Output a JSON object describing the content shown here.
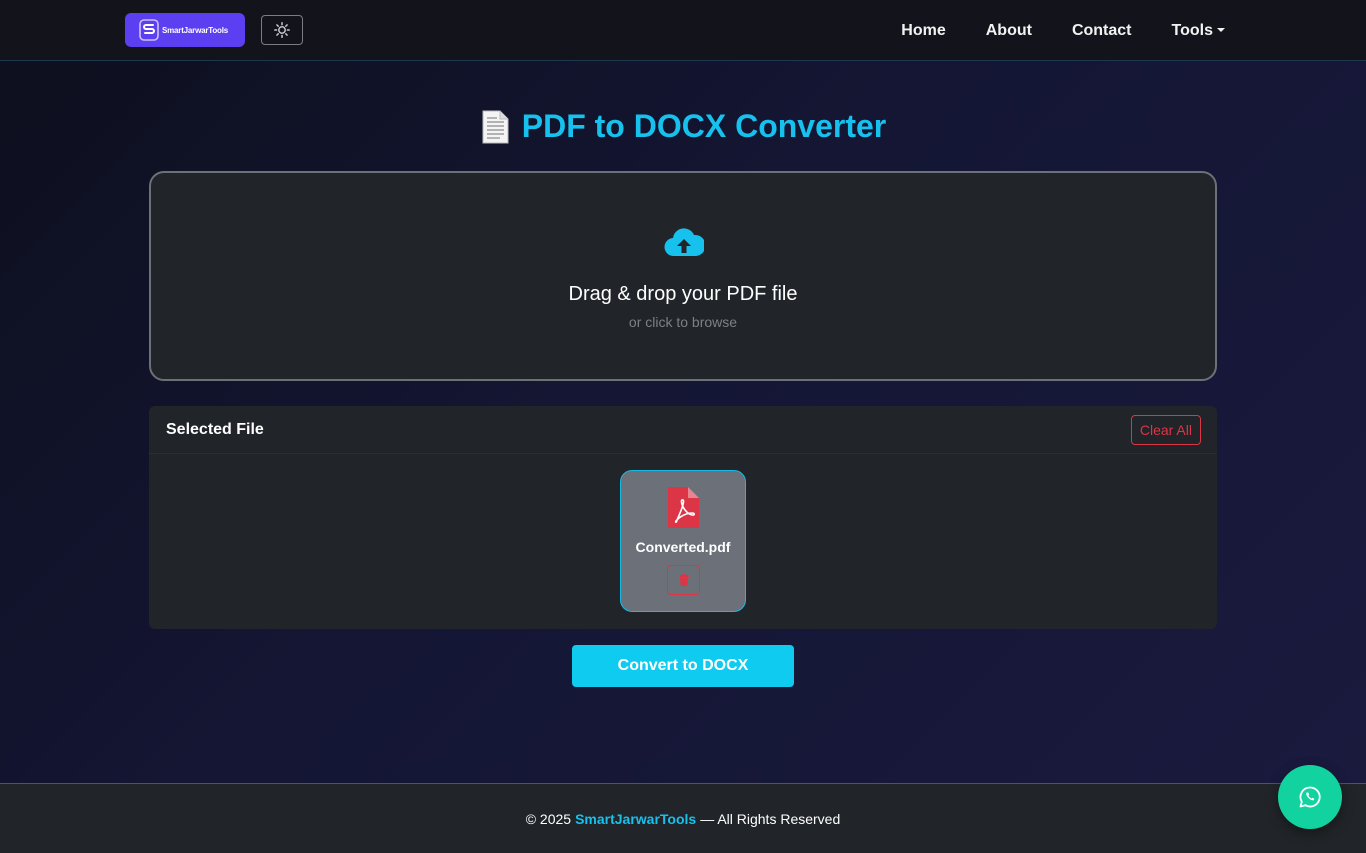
{
  "brand": {
    "name": "SmartJarwarTools"
  },
  "nav": {
    "home": "Home",
    "about": "About",
    "contact": "Contact",
    "tools": "Tools"
  },
  "page": {
    "title": "PDF to DOCX Converter"
  },
  "dropzone": {
    "main_text": "Drag & drop your PDF file",
    "sub_text": "or click to browse"
  },
  "selected": {
    "title": "Selected File",
    "clear_label": "Clear All",
    "files": [
      {
        "name": "Converted.pdf"
      }
    ]
  },
  "convert": {
    "label": "Convert to DOCX"
  },
  "footer": {
    "prefix": "© 2025",
    "brand": "SmartJarwarTools",
    "suffix": "— All Rights Reserved"
  },
  "colors": {
    "accent": "#16c1ee",
    "brand_bg": "#5b3ff0",
    "danger": "#dc3545",
    "whatsapp": "#12d3a0"
  },
  "icons": {
    "theme": "sun-icon",
    "upload": "cloud-upload-icon",
    "file": "file-pdf-icon",
    "delete": "trash-icon",
    "chat": "whatsapp-icon"
  }
}
